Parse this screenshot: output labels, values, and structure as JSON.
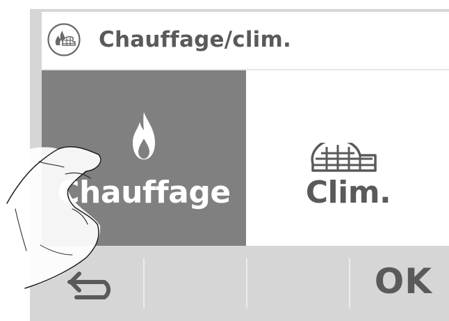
{
  "header": {
    "title": "Chauffage/clim.",
    "icon": "heating-cooling-icon"
  },
  "modes": [
    {
      "label": "Chauffage",
      "icon": "flame-icon",
      "selected": true
    },
    {
      "label": "Clim.",
      "icon": "igloo-icon",
      "selected": false
    }
  ],
  "footer": {
    "back_icon": "back-arrow-icon",
    "ok_label": "OK"
  },
  "colors": {
    "selected_tile": "#808080",
    "text": "#5a5a5a",
    "footer": "#d6d6d6"
  }
}
